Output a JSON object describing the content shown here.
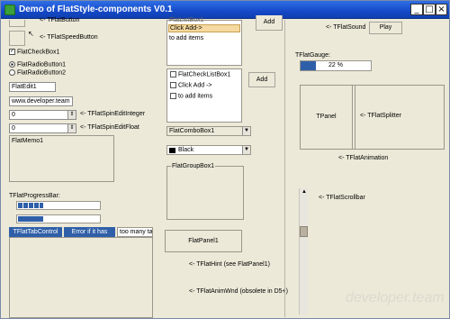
{
  "window": {
    "title": "Demo of FlatStyle-components V0.1"
  },
  "colors": {
    "accent": "#2f5fa8",
    "title_bar": "#1549c8",
    "selection": "#f5d9a0",
    "face": "#ece9d8"
  },
  "left": {
    "flatbutton_label": "<- TFlatButton",
    "speedbutton_label": "<- TFlatSpeedButton",
    "checkbox_label": "FlatCheckBox1",
    "radio1_label": "FlatRadioButton1",
    "radio2_label": "FlatRadioButton2",
    "edit1_value": "FlatEdit1",
    "edit2_value": "www.developer.team",
    "spin_int_value": "0",
    "spin_int_label": "<- TFlatSpinEditInteger",
    "spin_float_value": "0",
    "spin_float_label": "<- TFlatSpinEditFloat",
    "memo_text": "FlatMemo1",
    "progress_label": "TFlatProgressBar:",
    "progress1": 0.3,
    "progress2": 0.3,
    "tabs": [
      "TFlatTabControl",
      "Error if it has",
      "too many tal"
    ]
  },
  "middle": {
    "listbox_items": [
      "FlatListBox1",
      "Click Add->",
      "to add items"
    ],
    "add1_label": "Add",
    "add2_label": "Add",
    "checklist_items": [
      "FlatCheckListBox1",
      "Click Add ->",
      "to add items"
    ],
    "combo_value": "FlatComboBox1",
    "color_combo_value": "Black",
    "groupbox_label": "FlatGroupBox1",
    "panel1_label": "FlatPanel1",
    "hint_label": "<- TFlatHint (see FlatPanel1)",
    "animwnd_label": "<- TFlatAnimWnd (obsolete in D5+)"
  },
  "right": {
    "sound_label": "<- TFlatSound",
    "play_label": "Play",
    "gauge_label": "TFlatGauge:",
    "gauge_value": 0.22,
    "gauge_text": "22 %",
    "tpanel_label": "TPanel",
    "splitter_label": "<- TFlatSplitter",
    "animation_label": "<- TFlatAnimation",
    "scrollbar_label": "<- TFlatScrollbar",
    "scroll_position": 0.25,
    "watermark": "developer.team"
  }
}
